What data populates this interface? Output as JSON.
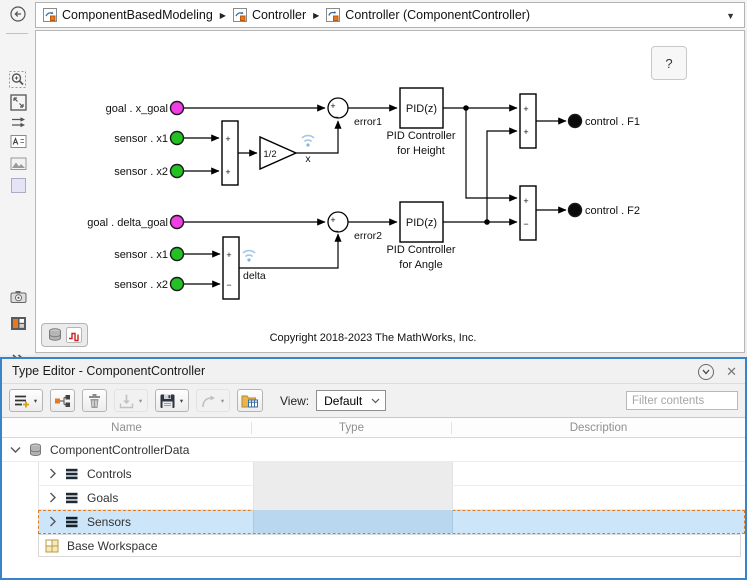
{
  "icons": {
    "close": "✕",
    "breadcrumb_separator": "▶",
    "dropdown_caret": "▼",
    "button_caret": "▾"
  },
  "breadcrumb": {
    "items": [
      {
        "label": "ComponentBasedModeling"
      },
      {
        "label": "Controller"
      },
      {
        "label": "Controller (ComponentController)"
      }
    ]
  },
  "canvas": {
    "help_button": "?",
    "copyright": "Copyright 2018-2023 The MathWorks, Inc."
  },
  "diagram": {
    "signs": {
      "plus": "+",
      "minus": "−"
    },
    "top": {
      "goal_label": "goal . x_goal",
      "sensor1_label": "sensor . x1",
      "sensor2_label": "sensor . x2",
      "gain_label": "1/2",
      "signal_label": "x",
      "error_label": "error1",
      "pid_label": "PID(z)",
      "pid_name_line1": "PID Controller",
      "pid_name_line2": "for Height",
      "output_label": "control . F1"
    },
    "bottom": {
      "goal_label": "goal . delta_goal",
      "sensor1_label": "sensor . x1",
      "sensor2_label": "sensor . x2",
      "signal_label": "delta",
      "error_label": "error2",
      "pid_label": "PID(z)",
      "pid_name_line1": "PID Controller",
      "pid_name_line2": "for Angle",
      "output_label": "control . F2"
    },
    "colors": {
      "goal_port": "#ee3ee4",
      "sensor_port": "#23c123",
      "control_port": "#0a0a0a",
      "logged_signal": "#9cc3e4"
    }
  },
  "type_editor": {
    "title": "Type Editor - ComponentController",
    "toolbar": {
      "view_label": "View:",
      "view_value": "Default",
      "filter_placeholder": "Filter contents"
    },
    "table": {
      "headers": [
        "Name",
        "Type",
        "Description"
      ],
      "root_name": "ComponentControllerData",
      "rows": [
        {
          "name": "Controls",
          "selected": false
        },
        {
          "name": "Goals",
          "selected": false
        },
        {
          "name": "Sensors",
          "selected": true
        }
      ],
      "base_row": "Base Workspace"
    }
  }
}
